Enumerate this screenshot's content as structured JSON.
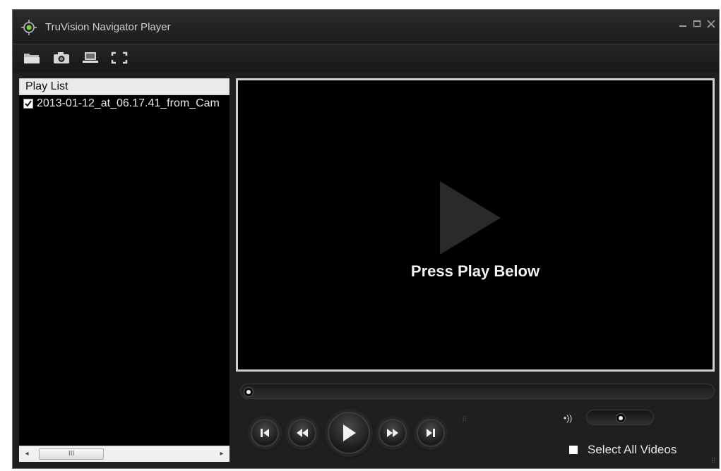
{
  "window": {
    "title": "TruVision Navigator Player",
    "controls": [
      "minimize",
      "maximize",
      "close"
    ]
  },
  "toolbar": {
    "buttons": [
      {
        "name": "open-folder",
        "icon": "folder-icon"
      },
      {
        "name": "snapshot",
        "icon": "camera-icon"
      },
      {
        "name": "export",
        "icon": "laptop-icon"
      },
      {
        "name": "fullscreen",
        "icon": "fullscreen-icon"
      }
    ]
  },
  "playlist": {
    "header": "Play List",
    "items": [
      {
        "label": "2013-01-12_at_06.17.41_from_Cam",
        "checked": true
      }
    ],
    "scrollbar_grip": "III"
  },
  "video": {
    "message": "Press Play Below",
    "playing": false
  },
  "seekbar": {
    "position": 0
  },
  "controls": {
    "buttons": [
      "step-back",
      "rewind",
      "play",
      "fast-forward",
      "step-forward"
    ]
  },
  "volume": {
    "level": 0.5
  },
  "select_all": {
    "label": "Select All Videos",
    "checked": false
  },
  "colors": {
    "window_bg": "#1f1f1f",
    "video_border": "#cfcfcf",
    "text": "#e6e6e6"
  }
}
